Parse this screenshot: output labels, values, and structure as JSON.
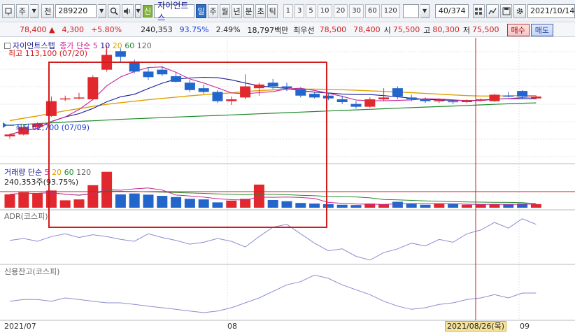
{
  "toolbar": {
    "main_type": "주",
    "sub_type": "전",
    "code": "289220",
    "new_badge": "신",
    "stock_name": "자이언트스",
    "periods": [
      "일",
      "주",
      "월",
      "년",
      "분",
      "초",
      "틱"
    ],
    "active_period": "일",
    "intervals": [
      "1",
      "3",
      "5",
      "10",
      "20",
      "30",
      "60",
      "120"
    ],
    "count_display": "40",
    "count_total": "/374",
    "date": "2021/10/14"
  },
  "quote": {
    "price": "78,400",
    "change_arrow": "▲",
    "change": "4,300",
    "change_pct": "+5.80%",
    "volume": "240,353",
    "volume_ratio": "93.75%",
    "turnover": "2.49%",
    "amount": "18,797백만",
    "best_ask_label": "최우선",
    "best_ask": "78,500",
    "best_bid": "78,400",
    "open_label": "시",
    "open": "75,500",
    "high_label": "고",
    "high": "80,300",
    "low_label": "저",
    "low": "75,500",
    "buy_label": "매수",
    "sell_label": "매도"
  },
  "price_panel": {
    "name": "자이언트스텝",
    "ma_label": "종가 단순",
    "ma_periods": [
      "5",
      "10",
      "20",
      "60",
      "120"
    ],
    "high_annotation": "최고 113,100 (07/20)",
    "low_annotation": "최저 62,700 (07/09)",
    "ma_colors": {
      "5": "#c8269a",
      "10": "#1a1a9a",
      "20": "#e0a000",
      "60": "#1f8a2c",
      "120": "#666666"
    }
  },
  "volume_panel": {
    "label": "거래량 단순",
    "ma_periods": [
      "5",
      "20",
      "60",
      "120"
    ],
    "current": "240,353주(93.75%)"
  },
  "adr_panel": {
    "label": "ADR(코스피)"
  },
  "credit_panel": {
    "label": "신용잔고(코스피)"
  },
  "x_axis": {
    "labels": [
      "2021/07",
      "08",
      "09"
    ],
    "cursor_date": "2021/08/26(목)"
  },
  "colors": {
    "up": "#e0282e",
    "down": "#2266cc",
    "highlight_box": "#d41b1b",
    "cursor_line": "#d41b1b"
  },
  "price_candles": [
    {
      "o": 64000,
      "h": 65500,
      "l": 62700,
      "c": 65000
    },
    {
      "o": 65000,
      "h": 70000,
      "l": 64500,
      "c": 69000
    },
    {
      "o": 69000,
      "h": 71500,
      "l": 67500,
      "c": 71000
    },
    {
      "o": 75000,
      "h": 85500,
      "l": 74500,
      "c": 83000
    },
    {
      "o": 84000,
      "h": 86000,
      "l": 83000,
      "c": 84500
    },
    {
      "o": 85000,
      "h": 87500,
      "l": 84000,
      "c": 85000
    },
    {
      "o": 84000,
      "h": 97000,
      "l": 83500,
      "c": 96000
    },
    {
      "o": 100000,
      "h": 113100,
      "l": 99000,
      "c": 108000
    },
    {
      "o": 110000,
      "h": 111500,
      "l": 104000,
      "c": 107000
    },
    {
      "o": 104500,
      "h": 105500,
      "l": 98000,
      "c": 99000
    },
    {
      "o": 99000,
      "h": 101000,
      "l": 94500,
      "c": 96000
    },
    {
      "o": 100000,
      "h": 102000,
      "l": 96500,
      "c": 97500
    },
    {
      "o": 96500,
      "h": 98500,
      "l": 93000,
      "c": 93500
    },
    {
      "o": 93000,
      "h": 94500,
      "l": 88000,
      "c": 89000
    },
    {
      "o": 90000,
      "h": 92000,
      "l": 87000,
      "c": 88000
    },
    {
      "o": 88000,
      "h": 89000,
      "l": 82000,
      "c": 83000
    },
    {
      "o": 83000,
      "h": 85500,
      "l": 81000,
      "c": 84000
    },
    {
      "o": 85000,
      "h": 97500,
      "l": 84000,
      "c": 91000
    },
    {
      "o": 90000,
      "h": 93000,
      "l": 86000,
      "c": 92000
    },
    {
      "o": 93000,
      "h": 95000,
      "l": 89500,
      "c": 91000
    },
    {
      "o": 91000,
      "h": 93000,
      "l": 88500,
      "c": 90000
    },
    {
      "o": 89500,
      "h": 90500,
      "l": 85000,
      "c": 86000
    },
    {
      "o": 87000,
      "h": 88000,
      "l": 84500,
      "c": 85000
    },
    {
      "o": 86000,
      "h": 87500,
      "l": 83500,
      "c": 84500
    },
    {
      "o": 84000,
      "h": 86000,
      "l": 81500,
      "c": 82500
    },
    {
      "o": 81500,
      "h": 83000,
      "l": 79000,
      "c": 80000
    },
    {
      "o": 80000,
      "h": 85000,
      "l": 79500,
      "c": 84000
    },
    {
      "o": 84000,
      "h": 90000,
      "l": 83000,
      "c": 85000
    },
    {
      "o": 90000,
      "h": 91000,
      "l": 84000,
      "c": 85500
    },
    {
      "o": 85000,
      "h": 86500,
      "l": 83000,
      "c": 84000
    },
    {
      "o": 84000,
      "h": 85000,
      "l": 82000,
      "c": 83000
    },
    {
      "o": 83000,
      "h": 84500,
      "l": 82000,
      "c": 83500
    },
    {
      "o": 83000,
      "h": 84000,
      "l": 81500,
      "c": 82500
    },
    {
      "o": 82500,
      "h": 84000,
      "l": 82000,
      "c": 83500
    },
    {
      "o": 83500,
      "h": 84500,
      "l": 83000,
      "c": 84000
    },
    {
      "o": 83000,
      "h": 87000,
      "l": 82500,
      "c": 86500
    },
    {
      "o": 86000,
      "h": 88000,
      "l": 85000,
      "c": 85500
    },
    {
      "o": 88500,
      "h": 89000,
      "l": 84000,
      "c": 85500
    },
    {
      "o": 84500,
      "h": 86000,
      "l": 84000,
      "c": 85500
    }
  ],
  "volume_values": [
    45,
    52,
    48,
    58,
    25,
    28,
    76,
    121,
    45,
    48,
    44,
    40,
    36,
    30,
    28,
    18,
    24,
    30,
    78,
    26,
    22,
    16,
    14,
    12,
    10,
    9,
    14,
    12,
    20,
    14,
    10,
    13,
    12,
    10,
    12,
    11,
    12,
    14,
    12
  ],
  "ma20_price": [
    72500,
    73800,
    75000,
    76400,
    77800,
    79000,
    80200,
    81300,
    82200,
    83000,
    83800,
    84500,
    85200,
    85900,
    86500,
    87000,
    87500,
    88200,
    88700,
    89100,
    89400,
    89500,
    89500,
    89400,
    89200,
    88900,
    88600,
    88300,
    88000,
    87600,
    87200,
    86800,
    86400,
    86000,
    85800,
    85800,
    85900,
    86000,
    86000
  ],
  "ma60_price": [
    70000,
    70500,
    70900,
    71300,
    71700,
    72100,
    72400,
    72800,
    73200,
    73500,
    73800,
    74100,
    74400,
    74700,
    75000,
    75300,
    75600,
    75900,
    76200,
    76500,
    76800,
    77100,
    77400,
    77700,
    78000,
    78300,
    78600,
    78900,
    79200,
    79500,
    79800,
    80100,
    80400,
    80700,
    81000,
    81300,
    81600,
    81900,
    82100
  ],
  "adr_values": [
    97,
    99,
    96,
    101,
    104,
    100,
    103,
    101,
    98,
    96,
    104,
    100,
    97,
    93,
    95,
    99,
    96,
    90,
    101,
    111,
    114,
    104,
    94,
    86,
    88,
    80,
    76,
    84,
    88,
    94,
    91,
    98,
    95,
    104,
    108,
    116,
    110,
    120,
    114
  ],
  "credit_values": [
    10,
    11,
    11,
    10,
    12,
    11,
    10,
    9,
    9,
    8,
    7,
    6,
    5,
    4,
    3,
    4,
    6,
    9,
    12,
    16,
    20,
    22,
    26,
    24,
    20,
    17,
    14,
    10,
    7,
    5,
    6,
    8,
    9,
    11,
    12,
    14,
    12,
    15,
    15
  ]
}
